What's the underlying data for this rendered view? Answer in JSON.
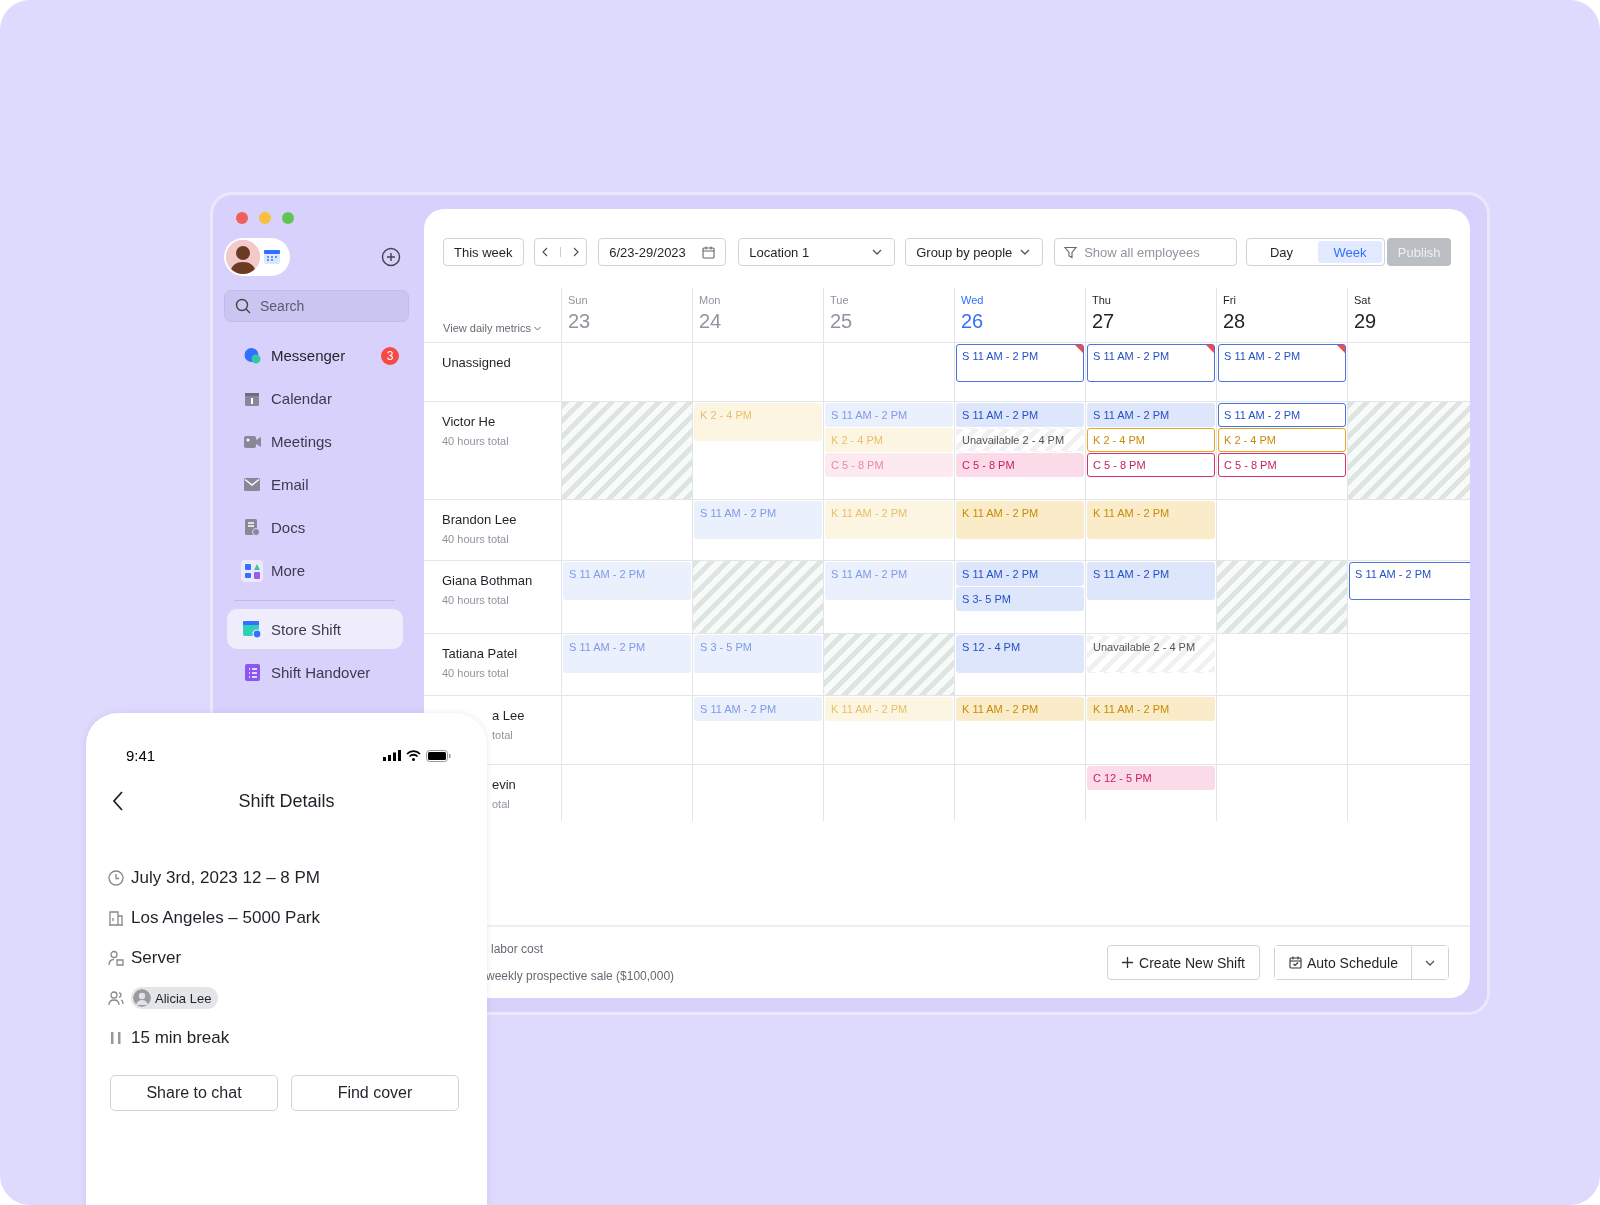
{
  "sidebar": {
    "search": {
      "placeholder": "Search"
    },
    "apps": [
      {
        "label": "Messenger",
        "selected": false,
        "badge": "3"
      },
      {
        "label": "Calendar",
        "selected": false
      },
      {
        "label": "Meetings",
        "selected": false
      },
      {
        "label": "Email",
        "selected": false
      },
      {
        "label": "Docs",
        "selected": false
      },
      {
        "label": "More",
        "selected": false
      }
    ],
    "workspace": [
      {
        "label": "Store Shift",
        "selected": true
      },
      {
        "label": "Shift Handover",
        "selected": false
      }
    ]
  },
  "toolbar": {
    "this_week": "This week",
    "date_range": "6/23-29/2023",
    "location": "Location 1",
    "group_by": "Group by people",
    "filter": {
      "placeholder": "Show all employees"
    },
    "views": [
      {
        "label": "Day",
        "selected": false
      },
      {
        "label": "Week",
        "selected": true
      }
    ],
    "publish": {
      "label": "Publish",
      "disabled": true
    }
  },
  "schedule": {
    "metrics_toggle": "View daily metrics",
    "days": [
      {
        "dow": "Sun",
        "date": "23",
        "past": true,
        "today": false
      },
      {
        "dow": "Mon",
        "date": "24",
        "past": true,
        "today": false
      },
      {
        "dow": "Tue",
        "date": "25",
        "past": true,
        "today": false
      },
      {
        "dow": "Wed",
        "date": "26",
        "past": false,
        "today": true
      },
      {
        "dow": "Thu",
        "date": "27",
        "past": false,
        "today": false
      },
      {
        "dow": "Fri",
        "date": "28",
        "past": false,
        "today": false
      },
      {
        "dow": "Sat",
        "date": "29",
        "past": false,
        "today": false
      }
    ],
    "rows": [
      {
        "name": "Unassigned",
        "partly_hidden": false,
        "cells": [
          {
            "hatched": false
          },
          {
            "hatched": false
          },
          {
            "hatched": false
          },
          {
            "hatched": false,
            "shifts": [
              {
                "label": "S 11 AM - 2 PM",
                "kind": "server",
                "draft": true,
                "flagged": true
              }
            ]
          },
          {
            "hatched": false,
            "shifts": [
              {
                "label": "S 11 AM - 2 PM",
                "kind": "server",
                "draft": true,
                "flagged": true
              }
            ]
          },
          {
            "hatched": false,
            "shifts": [
              {
                "label": "S 11 AM - 2 PM",
                "kind": "server",
                "draft": true,
                "flagged": true
              }
            ]
          },
          {
            "hatched": false
          }
        ]
      },
      {
        "name": "Victor He",
        "hours": "40 hours total",
        "partly_hidden": false,
        "cells": [
          {
            "hatched": true
          },
          {
            "hatched": false,
            "shifts": [
              {
                "label": "K 2 - 4 PM",
                "kind": "kitchen",
                "draft": false,
                "flagged": false
              }
            ]
          },
          {
            "hatched": false,
            "shifts": [
              {
                "label": "S 11 AM - 2 PM",
                "kind": "server",
                "draft": false,
                "flagged": false
              },
              {
                "label": "K 2 - 4 PM",
                "kind": "kitchen",
                "draft": false,
                "flagged": false
              },
              {
                "label": "C 5 - 8 PM",
                "kind": "cashier",
                "draft": false,
                "flagged": false
              }
            ]
          },
          {
            "hatched": false,
            "shifts": [
              {
                "label": "S 11 AM - 2 PM",
                "kind": "server",
                "draft": false,
                "flagged": false
              },
              {
                "label": "Unavailable 2 - 4 PM",
                "kind": "unavailable",
                "flagged": false
              },
              {
                "label": "C 5 - 8 PM",
                "kind": "cashier",
                "draft": false,
                "flagged": false
              }
            ]
          },
          {
            "hatched": false,
            "shifts": [
              {
                "label": "S 11 AM - 2 PM",
                "kind": "server",
                "draft": false,
                "flagged": false
              },
              {
                "label": "K 2 - 4 PM",
                "kind": "kitchen",
                "draft": true,
                "flagged": false
              },
              {
                "label": "C 5 - 8 PM",
                "kind": "cashier",
                "draft": true,
                "flagged": false
              }
            ]
          },
          {
            "hatched": false,
            "shifts": [
              {
                "label": "S 11 AM - 2 PM",
                "kind": "server",
                "draft": true,
                "flagged": false
              },
              {
                "label": "K 2 - 4 PM",
                "kind": "kitchen",
                "draft": true,
                "flagged": false
              },
              {
                "label": "C 5 - 8 PM",
                "kind": "cashier",
                "draft": true,
                "flagged": false
              }
            ]
          },
          {
            "hatched": true
          }
        ]
      },
      {
        "name": "Brandon Lee",
        "hours": "40 hours total",
        "partly_hidden": false,
        "cells": [
          {
            "hatched": false
          },
          {
            "hatched": false,
            "shifts": [
              {
                "label": "S 11 AM - 2 PM",
                "kind": "server",
                "draft": false,
                "flagged": false
              }
            ]
          },
          {
            "hatched": false,
            "shifts": [
              {
                "label": "K 11 AM - 2 PM",
                "kind": "kitchen",
                "draft": false,
                "flagged": false
              }
            ]
          },
          {
            "hatched": false,
            "shifts": [
              {
                "label": "K 11 AM - 2 PM",
                "kind": "kitchen",
                "draft": false,
                "flagged": false
              }
            ]
          },
          {
            "hatched": false,
            "shifts": [
              {
                "label": "K 11 AM - 2 PM",
                "kind": "kitchen",
                "draft": false,
                "flagged": false
              }
            ]
          },
          {
            "hatched": false
          },
          {
            "hatched": false
          }
        ]
      },
      {
        "name": "Giana Bothman",
        "hours": "40 hours total",
        "partly_hidden": false,
        "cells": [
          {
            "hatched": false,
            "shifts": [
              {
                "label": "S 11 AM - 2 PM",
                "kind": "server",
                "draft": false,
                "flagged": false
              }
            ]
          },
          {
            "hatched": true
          },
          {
            "hatched": false,
            "shifts": [
              {
                "label": "S 11 AM - 2 PM",
                "kind": "server",
                "draft": false,
                "flagged": false
              }
            ]
          },
          {
            "hatched": false,
            "shifts": [
              {
                "label": "S 11 AM - 2 PM",
                "kind": "server",
                "draft": false,
                "flagged": false
              },
              {
                "label": "S 3- 5 PM",
                "kind": "server",
                "draft": false,
                "flagged": false
              }
            ]
          },
          {
            "hatched": false,
            "shifts": [
              {
                "label": "S 11 AM - 2 PM",
                "kind": "server",
                "draft": false,
                "flagged": false
              }
            ]
          },
          {
            "hatched": true
          },
          {
            "hatched": false,
            "shifts": [
              {
                "label": "S 11 AM - 2 PM",
                "kind": "server",
                "draft": true,
                "flagged": false
              }
            ]
          }
        ]
      },
      {
        "name": "Tatiana Patel",
        "hours": "40 hours total",
        "partly_hidden": false,
        "cells": [
          {
            "hatched": false,
            "shifts": [
              {
                "label": "S 11 AM - 2 PM",
                "kind": "server",
                "draft": false,
                "flagged": false
              }
            ]
          },
          {
            "hatched": false,
            "shifts": [
              {
                "label": "S 3 - 5 PM",
                "kind": "server",
                "draft": false,
                "flagged": false
              }
            ]
          },
          {
            "hatched": true
          },
          {
            "hatched": false,
            "shifts": [
              {
                "label": "S 12 - 4 PM",
                "kind": "server",
                "draft": false,
                "flagged": false
              }
            ]
          },
          {
            "hatched": false,
            "shifts": [
              {
                "label": "Unavailable 2 - 4 PM",
                "kind": "unavailable",
                "flagged": false
              }
            ]
          },
          {
            "hatched": false
          },
          {
            "hatched": false
          }
        ]
      },
      {
        "name": "a Lee",
        "hours": "total",
        "partly_hidden": true,
        "cells": [
          {
            "hatched": false
          },
          {
            "hatched": false,
            "shifts": [
              {
                "label": "S 11 AM - 2 PM",
                "kind": "server",
                "draft": false,
                "flagged": false
              }
            ]
          },
          {
            "hatched": false,
            "shifts": [
              {
                "label": "K 11 AM - 2 PM",
                "kind": "kitchen",
                "draft": false,
                "flagged": false
              }
            ]
          },
          {
            "hatched": false,
            "shifts": [
              {
                "label": "K 11 AM - 2 PM",
                "kind": "kitchen",
                "draft": false,
                "flagged": false
              }
            ]
          },
          {
            "hatched": false,
            "shifts": [
              {
                "label": "K 11 AM - 2 PM",
                "kind": "kitchen",
                "draft": false,
                "flagged": false
              }
            ]
          },
          {
            "hatched": false
          },
          {
            "hatched": false
          }
        ]
      },
      {
        "name": "evin",
        "hours": "otal",
        "partly_hidden": true,
        "cells": [
          {
            "hatched": false
          },
          {
            "hatched": false
          },
          {
            "hatched": false
          },
          {
            "hatched": false
          },
          {
            "hatched": false,
            "shifts": [
              {
                "label": "C 12 - 5 PM",
                "kind": "cashier",
                "draft": false,
                "flagged": false
              }
            ]
          },
          {
            "hatched": false
          },
          {
            "hatched": false
          }
        ]
      }
    ]
  },
  "footer": {
    "metrics": [
      "labor cost",
      "weekly prospective sale ($100,000)"
    ],
    "create_button": "Create New Shift",
    "auto_schedule": "Auto Schedule"
  },
  "phone": {
    "time": "9:41",
    "title": "Shift Details",
    "details": [
      {
        "kind": "text",
        "text": "July 3rd, 2023 12 – 8 PM"
      },
      {
        "kind": "text",
        "text": "Los Angeles – 5000 Park"
      },
      {
        "kind": "text",
        "text": "Server"
      },
      {
        "kind": "person",
        "text": "Alicia Lee"
      },
      {
        "kind": "text",
        "text": "15 min break"
      }
    ],
    "buttons": [
      "Share to chat",
      "Find cover"
    ]
  }
}
